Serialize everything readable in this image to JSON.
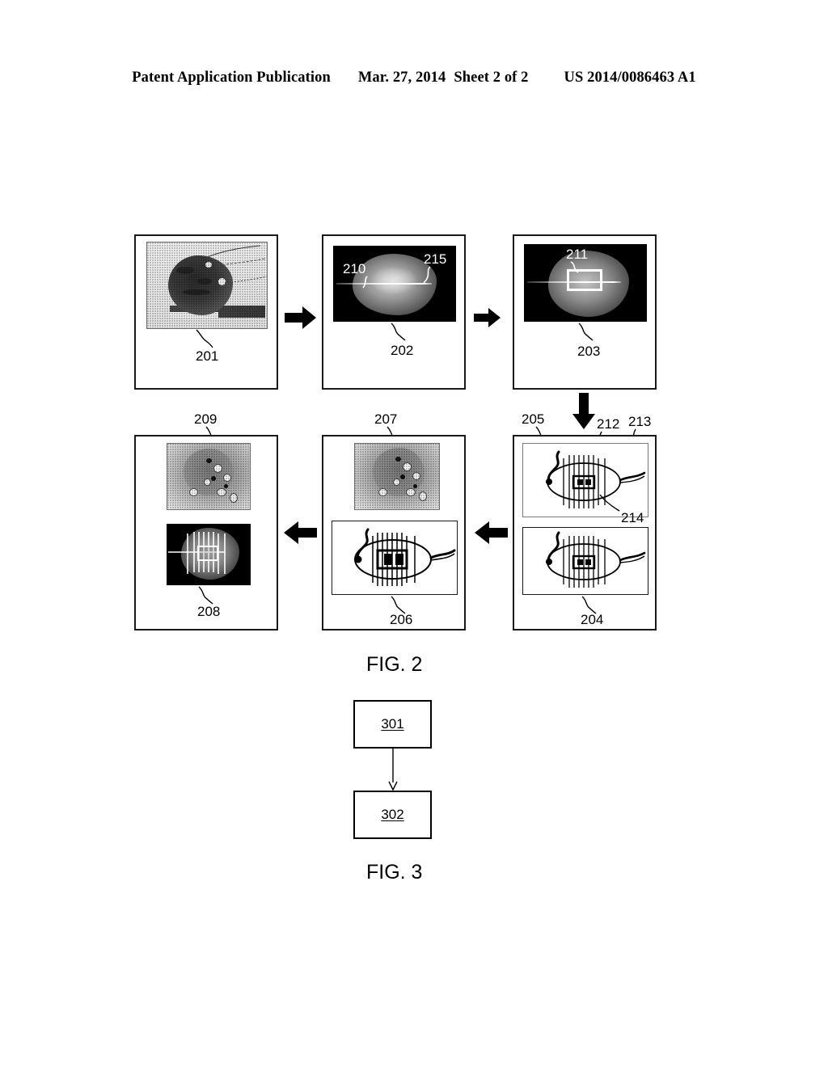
{
  "header": {
    "left": "Patent Application Publication",
    "date": "Mar. 27, 2014",
    "sheet": "Sheet 2 of 2",
    "pubnum": "US 2014/0086463 A1"
  },
  "figures": [
    {
      "id": "fig2",
      "caption": "FIG. 2"
    },
    {
      "id": "fig3",
      "caption": "FIG. 3"
    }
  ],
  "fig2": {
    "caption": "FIG. 2",
    "panels": [
      {
        "id": "p201",
        "label": "201",
        "content": "specimen-photograph",
        "row": 1,
        "col": 1
      },
      {
        "id": "p202",
        "label": "202",
        "content": "grayscale-scan-dark",
        "row": 1,
        "col": 2
      },
      {
        "id": "p203",
        "label": "203",
        "content": "grayscale-scan-dark-with-roi-box",
        "row": 1,
        "col": 3
      },
      {
        "id": "p205",
        "label": "205",
        "content": "schematic-ellipse-with-grid",
        "row": 2,
        "col": 3
      },
      {
        "id": "p204",
        "label": "204",
        "content": "schematic-ellipse-with-grid",
        "row": 2,
        "col": 3
      },
      {
        "id": "p207",
        "label": "207",
        "content": "histology-image",
        "row": 2,
        "col": 2
      },
      {
        "id": "p206",
        "label": "206",
        "content": "schematic-ellipse-with-grid",
        "row": 2,
        "col": 2
      },
      {
        "id": "p209",
        "label": "209",
        "content": "histology-image",
        "row": 2,
        "col": 1
      },
      {
        "id": "p208",
        "label": "208",
        "content": "grayscale-scan-dark-with-grid-overlay",
        "row": 2,
        "col": 1
      }
    ],
    "callouts": [
      {
        "label": "210",
        "panel": "p202",
        "style": "white"
      },
      {
        "label": "215",
        "panel": "p202",
        "style": "white"
      },
      {
        "label": "211",
        "panel": "p203",
        "style": "white"
      },
      {
        "label": "212",
        "panel": "p205",
        "style": "black"
      },
      {
        "label": "213",
        "panel": "p205",
        "style": "black"
      },
      {
        "label": "214",
        "panel": "p205",
        "style": "black"
      }
    ],
    "flow_arrows": [
      {
        "name": "arrow-201-to-202",
        "direction": "right"
      },
      {
        "name": "arrow-202-to-203",
        "direction": "right"
      },
      {
        "name": "arrow-203-to-205",
        "direction": "down"
      },
      {
        "name": "arrow-204-to-206",
        "direction": "left"
      },
      {
        "name": "arrow-206-to-208",
        "direction": "left"
      }
    ]
  },
  "fig3": {
    "caption": "FIG. 3",
    "steps": [
      {
        "id": "s301",
        "label": "301"
      },
      {
        "id": "s302",
        "label": "302"
      }
    ],
    "connector": {
      "name": "arrow-301-to-302",
      "direction": "down"
    }
  }
}
